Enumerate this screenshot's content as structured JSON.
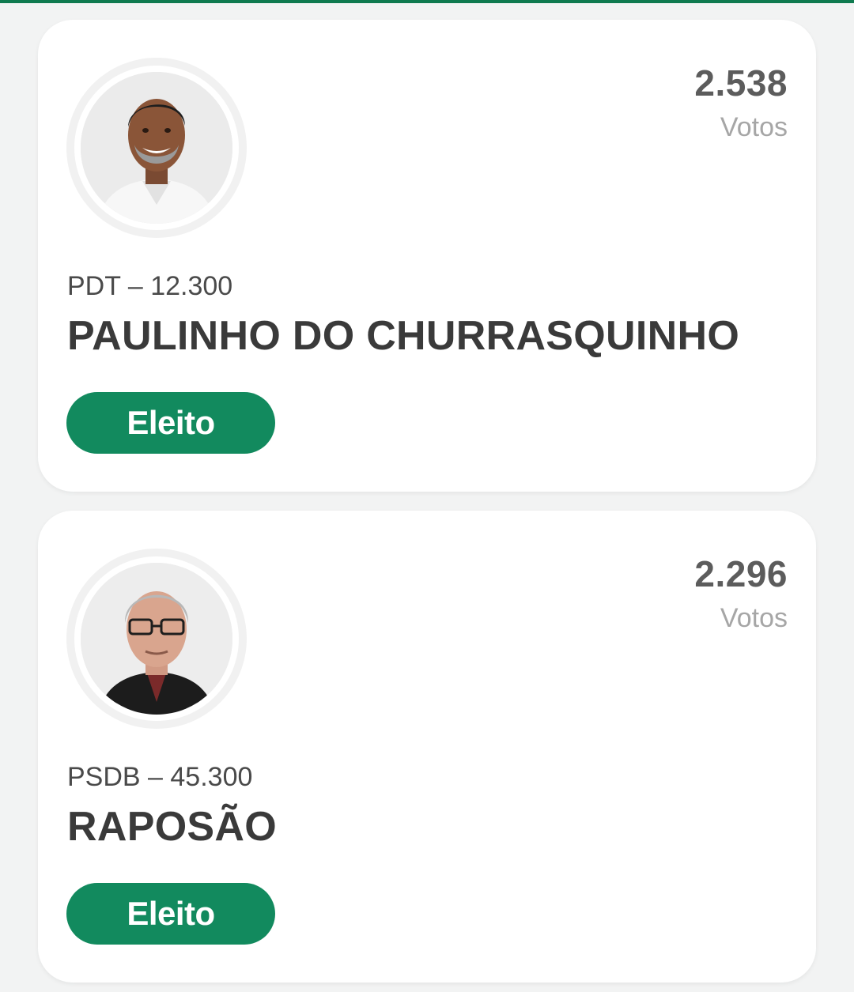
{
  "candidates": [
    {
      "votes": "2.538",
      "votes_label": "Votos",
      "party_line": "PDT – 12.300",
      "name": "PAULINHO DO CHURRASQUINHO",
      "status": "Eleito",
      "avatar_icon": "candidate-photo"
    },
    {
      "votes": "2.296",
      "votes_label": "Votos",
      "party_line": "PSDB – 45.300",
      "name": "RAPOSÃO",
      "status": "Eleito",
      "avatar_icon": "candidate-photo"
    }
  ],
  "colors": {
    "accent": "#0f7a4f",
    "badge": "#128a5e",
    "background": "#f2f3f3"
  }
}
